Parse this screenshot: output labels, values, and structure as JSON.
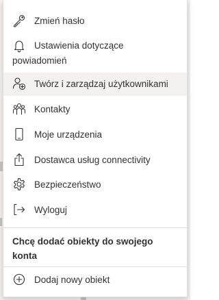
{
  "menu": {
    "items": [
      {
        "label": "Zmień hasło",
        "icon": "key-icon"
      },
      {
        "label_line1": "Ustawienia dotyczące",
        "label_line2": "powiadomień",
        "icon": "bell-icon"
      },
      {
        "label": "Twórz i zarządzaj użytkownikami",
        "icon": "person-add-icon"
      },
      {
        "label": "Kontakty",
        "icon": "people-icon"
      },
      {
        "label": "Moje urządzenia",
        "icon": "phone-icon"
      },
      {
        "label": "Dostawca usług connectivity",
        "icon": "share-icon"
      },
      {
        "label": "Bezpieczeństwo",
        "icon": "gear-icon"
      },
      {
        "label": "Wyloguj",
        "icon": "sign-out-icon"
      }
    ],
    "section": {
      "title": "Chcę dodać obiekty do swojego konta",
      "add_label": "Dodaj nowy obiekt",
      "add_icon": "add-circle-icon"
    }
  },
  "colors": {
    "text": "#323130",
    "hover_background": "#f3f2f1",
    "divider": "#e1dfdd"
  }
}
